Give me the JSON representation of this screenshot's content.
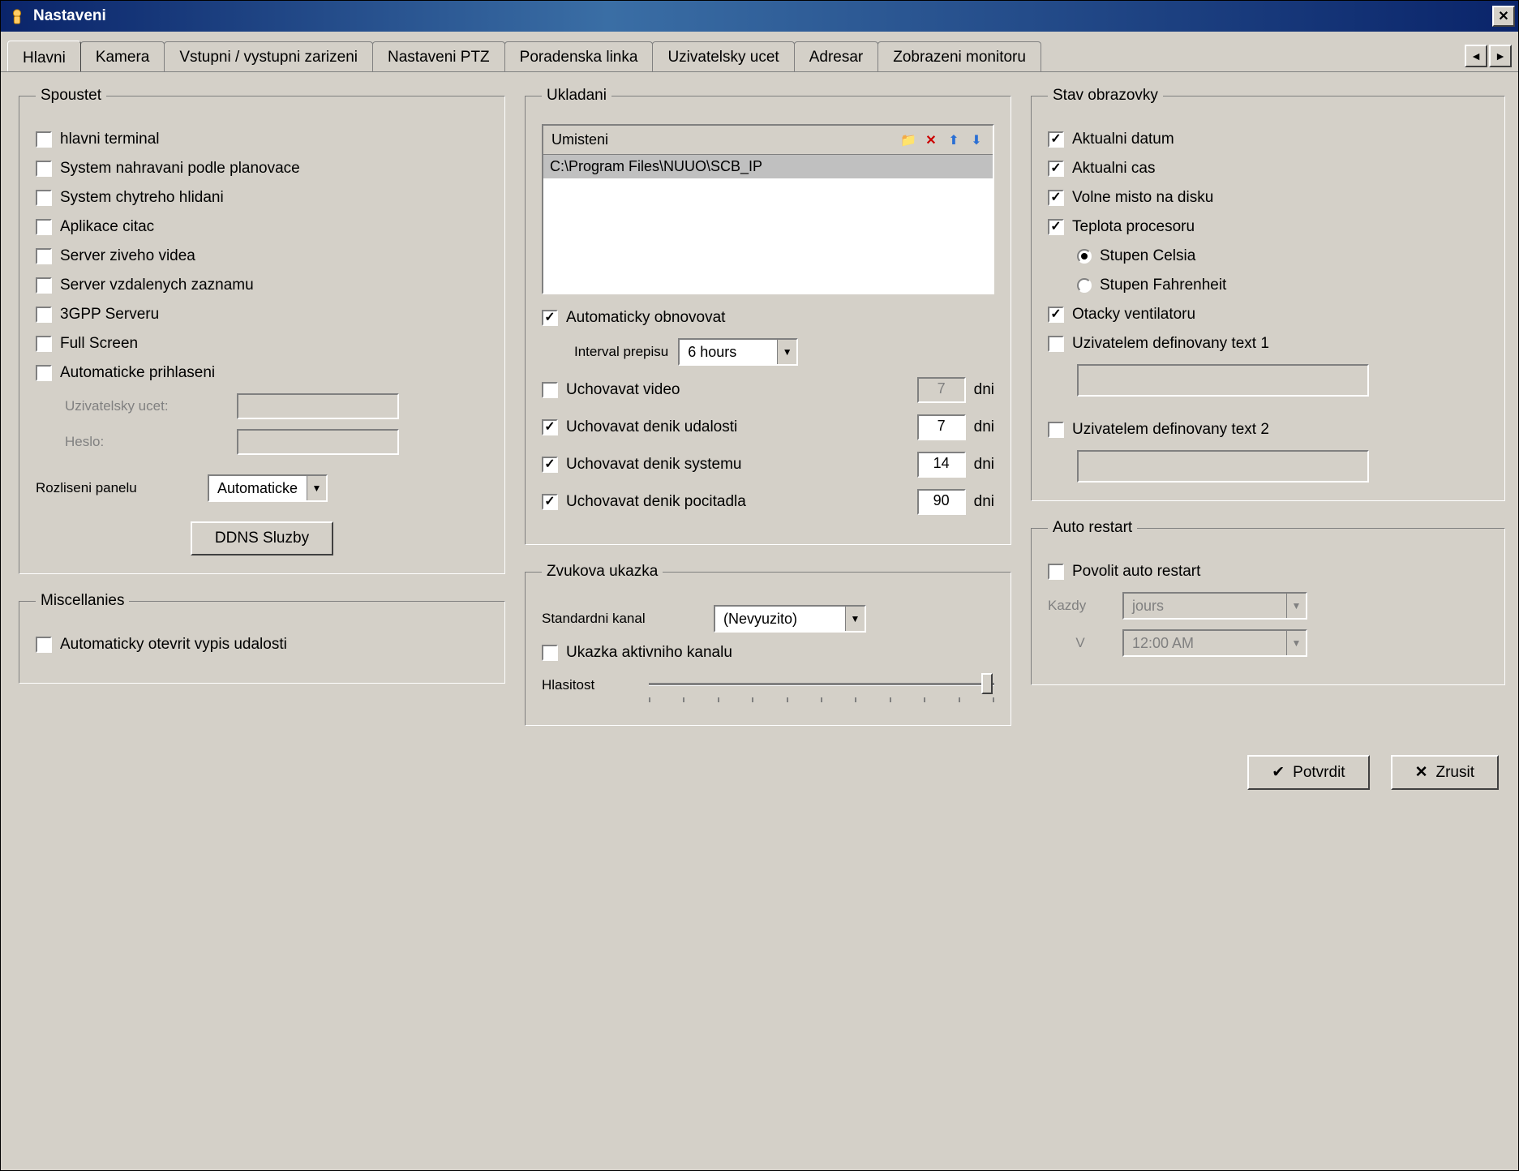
{
  "window": {
    "title": "Nastaveni"
  },
  "tabs": {
    "items": [
      "Hlavni",
      "Kamera",
      "Vstupni / vystupni zarizeni",
      "Nastaveni PTZ",
      "Poradenska linka",
      "Uzivatelsky ucet",
      "Adresar",
      "Zobrazeni monitoru"
    ],
    "active_index": 0
  },
  "startup": {
    "legend": "Spoustet",
    "items": {
      "main_terminal": "hlavni terminal",
      "record_plan": "System nahravani podle planovace",
      "smart_guard": "System chytreho hlidani",
      "reader_app": "Aplikace citac",
      "live_server": "Server ziveho videa",
      "remote_server": "Server vzdalenych zaznamu",
      "gpp_server": "3GPP Serveru",
      "full_screen": "Full Screen",
      "auto_login": "Automaticke prihlaseni"
    },
    "auto_login_fields": {
      "user_label": "Uzivatelsky ucet:",
      "pass_label": "Heslo:",
      "user_value": "",
      "pass_value": ""
    },
    "resolution_label": "Rozliseni panelu",
    "resolution_value": "Automaticke",
    "ddns_button": "DDNS Sluzby"
  },
  "misc": {
    "legend": "Miscellanies",
    "open_eventlog": "Automaticky otevrit vypis udalosti"
  },
  "storage": {
    "legend": "Ukladani",
    "location_header": "Umisteni",
    "location_paths": [
      "C:\\Program Files\\NUUO\\SCB_IP"
    ],
    "auto_recycle": {
      "label": "Automaticky obnovovat",
      "checked": true
    },
    "interval_label": "Interval prepisu",
    "interval_value": "6 hours",
    "keep_video": {
      "label": "Uchovavat video",
      "checked": false,
      "value": "7",
      "unit": "dni"
    },
    "keep_eventlog": {
      "label": "Uchovavat denik udalosti",
      "checked": true,
      "value": "7",
      "unit": "dni"
    },
    "keep_systemlog": {
      "label": "Uchovavat denik systemu",
      "checked": true,
      "value": "14",
      "unit": "dni"
    },
    "keep_counterlog": {
      "label": "Uchovavat denik pocitadla",
      "checked": true,
      "value": "90",
      "unit": "dni"
    }
  },
  "audio": {
    "legend": "Zvukova ukazka",
    "default_channel_label": "Standardni kanal",
    "default_channel_value": "(Nevyuzito)",
    "active_channel_preview": "Ukazka aktivniho kanalu",
    "volume_label": "Hlasitost"
  },
  "status": {
    "legend": "Stav obrazovky",
    "current_date": "Aktualni datum",
    "current_time": "Aktualni cas",
    "free_space": "Volne misto na disku",
    "cpu_temp": "Teplota procesoru",
    "celsius": "Stupen Celsia",
    "fahrenheit": "Stupen Fahrenheit",
    "fan_speed": "Otacky ventilatoru",
    "user_text1": "Uzivatelem definovany text 1",
    "user_text1_value": "",
    "user_text2": "Uzivatelem definovany text 2",
    "user_text2_value": ""
  },
  "auto_restart": {
    "legend": "Auto restart",
    "enable": "Povolit auto restart",
    "every_label": "Kazdy",
    "every_value": "jours",
    "at_label": "V",
    "at_value": "12:00 AM"
  },
  "buttons": {
    "ok": "Potvrdit",
    "cancel": "Zrusit"
  }
}
